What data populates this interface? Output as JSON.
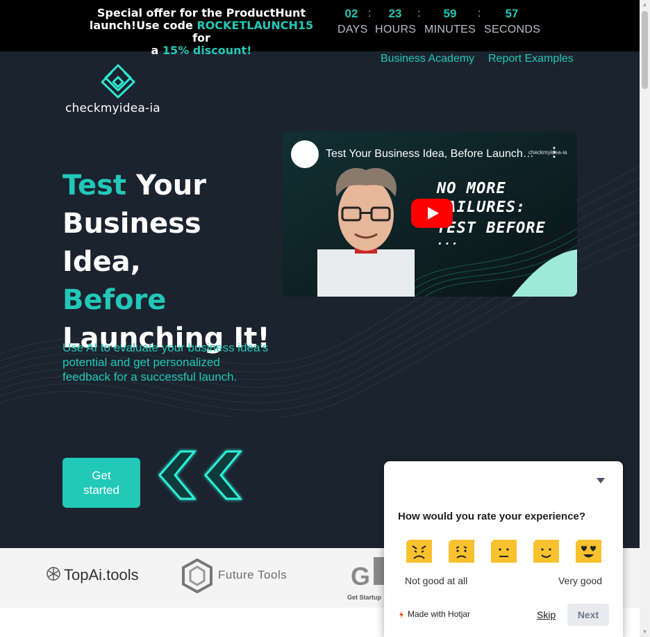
{
  "promo": {
    "line1": "Special offer for the ProductHunt",
    "line2_a": "launch!Use code ",
    "code": "ROCKETLAUNCH15",
    "line2_b": " for",
    "line3_a": "a ",
    "discount": "15% discount!",
    "countdown": [
      {
        "value": "02",
        "label": "DAYS"
      },
      {
        "value": "23",
        "label": "HOURS"
      },
      {
        "value": "59",
        "label": "MINUTES"
      },
      {
        "value": "57",
        "label": "SECONDS"
      }
    ],
    "separator": ":"
  },
  "nav": {
    "items": [
      {
        "label": "Business Academy"
      },
      {
        "label": "Report Examples"
      }
    ]
  },
  "brand": {
    "name": "checkmyidea-ia"
  },
  "hero": {
    "w1": "Test",
    "w2": " Your",
    "w3": "Business Idea,",
    "w4": "Before",
    "w5": "Launching It!",
    "subtitle": "Use AI to evaluate your business idea's potential and get personalized feedback for a successful launch.",
    "cta": "Get started"
  },
  "video": {
    "title": "Test Your Business Idea, Before Launching It!",
    "brand": "checkmyidea-ia",
    "overlay_lines": [
      "NO MORE",
      "FAILURES:",
      "TEST BEFORE",
      "..."
    ]
  },
  "partners": {
    "topai": "TopAi.tools",
    "futuretools": "Future Tools",
    "getstartup": "Get Startup"
  },
  "survey": {
    "question": "How would you rate your experience?",
    "low_label": "Not good at all",
    "high_label": "Very good",
    "made_with": "Made with Hotjar",
    "skip": "Skip",
    "next": "Next",
    "emojis": [
      "angry-face-icon",
      "frowning-face-icon",
      "neutral-face-icon",
      "smiling-face-icon",
      "heart-eyes-face-icon"
    ],
    "emoji_color": "#f9c12e"
  },
  "colors": {
    "accent": "#22c8b8",
    "background": "#1b232e"
  }
}
